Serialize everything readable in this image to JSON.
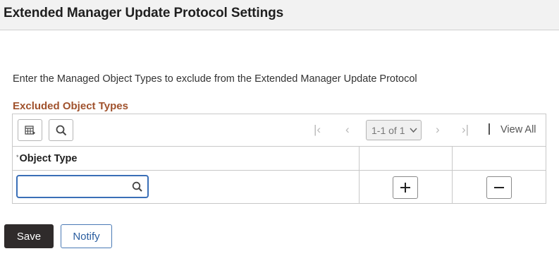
{
  "header": {
    "title": "Extended Manager Update Protocol Settings"
  },
  "instructions": "Enter the Managed Object Types to exclude from the Extended Manager Update Protocol",
  "grid": {
    "title": "Excluded Object Types",
    "toolbar": {
      "personalize_icon": "grid-personalize-icon",
      "search_icon": "search-icon",
      "pager": {
        "first": "|‹",
        "prev": "‹",
        "selected": "1-1 of 1",
        "next": "›",
        "last": "›|"
      },
      "view_all": "View All"
    },
    "columns": [
      {
        "label": "Object Type",
        "required_marker": "*"
      }
    ],
    "rows": [
      {
        "object_type": "",
        "add_icon": "plus-icon",
        "delete_icon": "minus-icon"
      }
    ]
  },
  "actions": {
    "save": "Save",
    "notify": "Notify"
  },
  "colors": {
    "grid_title": "#a0522d",
    "focus": "#3a6fb7",
    "save_bg": "#2f2b2b",
    "notify_text": "#2a5d9f"
  }
}
